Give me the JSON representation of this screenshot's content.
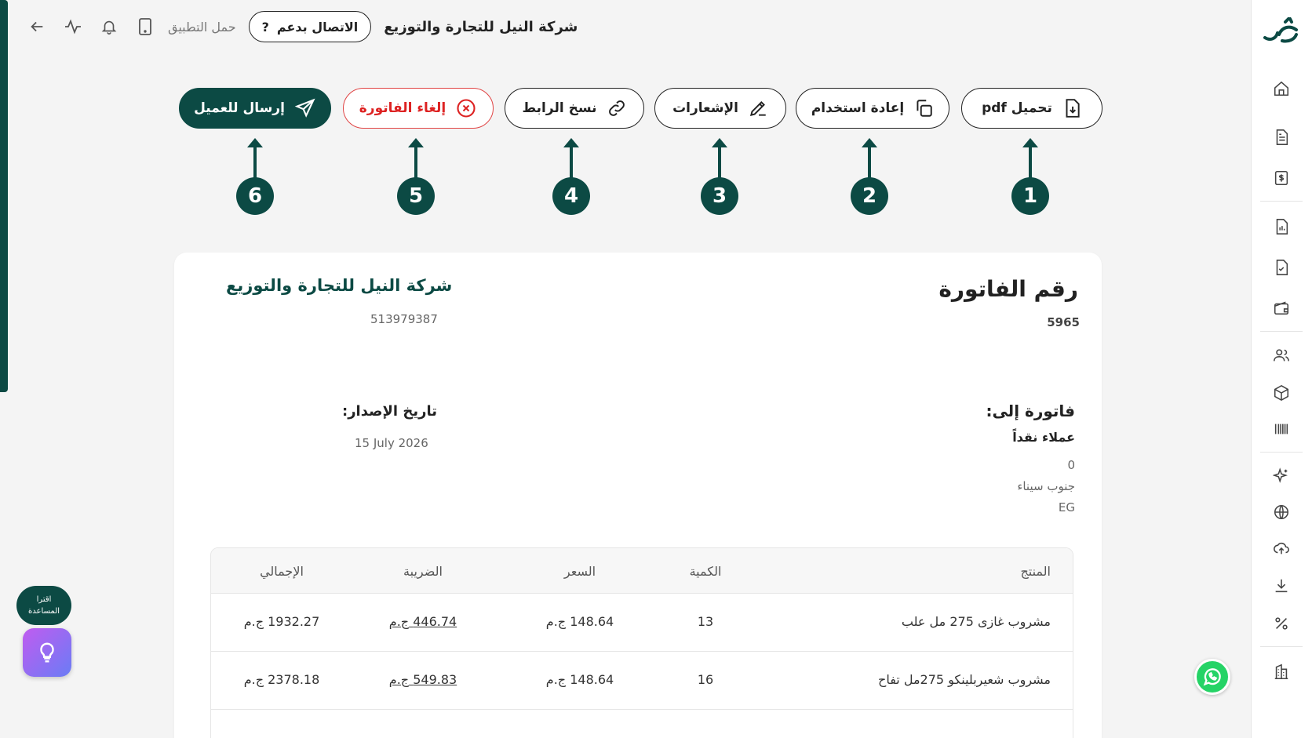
{
  "topbar": {
    "company": "شركة النيل للتجارة والتوزيع",
    "support_label": "الاتصال بدعم",
    "support_icon": "?",
    "download_app": "حمل التطبيق"
  },
  "actions": {
    "download_pdf": "تحميل pdf",
    "reuse": "إعادة استخدام",
    "notices": "الإشعارات",
    "copy_link": "نسخ الرابط",
    "cancel_invoice": "إلغاء الفاتورة",
    "send_client": "إرسال للعميل"
  },
  "markers": [
    "1",
    "2",
    "3",
    "4",
    "5",
    "6"
  ],
  "invoice": {
    "number_label": "رقم الفاتورة",
    "number": "5965",
    "company_name": "شركة النيل للتجارة والتوزيع",
    "company_tax": "513979387",
    "bill_to_label": "فاتورة إلى:",
    "client_name": "عملاء نقداً",
    "address_line1": "0",
    "address_line2": "جنوب سيناء",
    "address_line3": "EG",
    "issue_label": "تاريخ الإصدار:",
    "issue_date": "15 July 2026"
  },
  "table": {
    "headers": {
      "product": "المنتج",
      "qty": "الكمية",
      "price": "السعر",
      "tax": "الضريبة",
      "total": "الإجمالي"
    },
    "currency": "ج.م",
    "rows": [
      {
        "product": "مشروب غازى 275 مل علب",
        "qty": "13",
        "price": "148.64",
        "tax": "446.74",
        "total": "1932.27"
      },
      {
        "product": "مشروب شعيربلينكو 275مل تفاح",
        "qty": "16",
        "price": "148.64",
        "tax": "549.83",
        "total": "2378.18"
      }
    ]
  },
  "help": {
    "line1": "اقترا",
    "line2": "المساعدة"
  },
  "colors": {
    "brand": "#0c4a44",
    "danger": "#d22222",
    "whatsapp": "#25d366"
  }
}
